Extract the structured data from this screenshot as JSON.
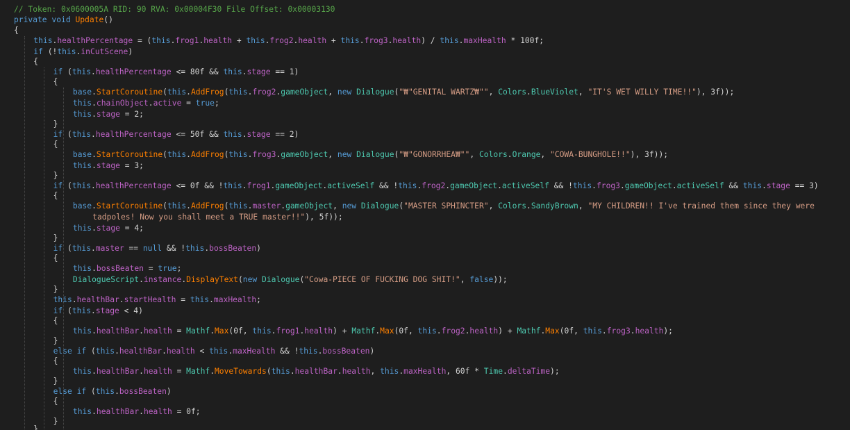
{
  "editor": {
    "language": "C#",
    "theme": {
      "background": "#1e1e1e",
      "default": "#d4d4d4",
      "keyword": "#569cd6",
      "comment": "#57a64a",
      "string": "#d69d85",
      "method": "#ff8000",
      "field": "#bd63c5",
      "type": "#4ec9b0"
    },
    "lines": [
      [
        [
          "// Token: 0x0600005A RID: 90 RVA: 0x00004F30 File Offset: 0x00003130",
          "c"
        ]
      ],
      [
        [
          "private",
          "k"
        ],
        [
          " ",
          "p"
        ],
        [
          "void",
          "k"
        ],
        [
          " ",
          "p"
        ],
        [
          "Update",
          "m"
        ],
        [
          "()",
          "p"
        ]
      ],
      [
        [
          "{",
          "p"
        ]
      ],
      [
        [
          "this",
          "k"
        ],
        [
          ".",
          "p"
        ],
        [
          "healthPercentage",
          "f"
        ],
        [
          " = (",
          "p"
        ],
        [
          "this",
          "k"
        ],
        [
          ".",
          "p"
        ],
        [
          "frog1",
          "f"
        ],
        [
          ".",
          "p"
        ],
        [
          "health",
          "f"
        ],
        [
          " + ",
          "p"
        ],
        [
          "this",
          "k"
        ],
        [
          ".",
          "p"
        ],
        [
          "frog2",
          "f"
        ],
        [
          ".",
          "p"
        ],
        [
          "health",
          "f"
        ],
        [
          " + ",
          "p"
        ],
        [
          "this",
          "k"
        ],
        [
          ".",
          "p"
        ],
        [
          "frog3",
          "f"
        ],
        [
          ".",
          "p"
        ],
        [
          "health",
          "f"
        ],
        [
          ") / ",
          "p"
        ],
        [
          "this",
          "k"
        ],
        [
          ".",
          "p"
        ],
        [
          "maxHealth",
          "f"
        ],
        [
          " * 100f;",
          "p"
        ]
      ],
      [
        [
          "if",
          "k"
        ],
        [
          " (!",
          "p"
        ],
        [
          "this",
          "k"
        ],
        [
          ".",
          "p"
        ],
        [
          "inCutScene",
          "f"
        ],
        [
          ")",
          "p"
        ]
      ],
      [
        [
          "{",
          "p"
        ]
      ],
      [
        [
          "if",
          "k"
        ],
        [
          " (",
          "p"
        ],
        [
          "this",
          "k"
        ],
        [
          ".",
          "p"
        ],
        [
          "healthPercentage",
          "f"
        ],
        [
          " <= 80f && ",
          "p"
        ],
        [
          "this",
          "k"
        ],
        [
          ".",
          "p"
        ],
        [
          "stage",
          "f"
        ],
        [
          " == 1)",
          "p"
        ]
      ],
      [
        [
          "{",
          "p"
        ]
      ],
      [
        [
          "base",
          "k"
        ],
        [
          ".",
          "p"
        ],
        [
          "StartCoroutine",
          "m"
        ],
        [
          "(",
          "p"
        ],
        [
          "this",
          "k"
        ],
        [
          ".",
          "p"
        ],
        [
          "AddFrog",
          "m"
        ],
        [
          "(",
          "p"
        ],
        [
          "this",
          "k"
        ],
        [
          ".",
          "p"
        ],
        [
          "frog2",
          "f"
        ],
        [
          ".",
          "p"
        ],
        [
          "gameObject",
          "ty"
        ],
        [
          ", ",
          "p"
        ],
        [
          "new",
          "k"
        ],
        [
          " ",
          "p"
        ],
        [
          "Dialogue",
          "ty"
        ],
        [
          "(",
          "p"
        ],
        [
          "\"₩\"GENITAL WARTZ₩\"\"",
          "s"
        ],
        [
          ", ",
          "p"
        ],
        [
          "Colors",
          "ty"
        ],
        [
          ".",
          "p"
        ],
        [
          "BlueViolet",
          "ty"
        ],
        [
          ", ",
          "p"
        ],
        [
          "\"IT'S WET WILLY TIME!!\"",
          "s"
        ],
        [
          "), 3f));",
          "p"
        ]
      ],
      [
        [
          "this",
          "k"
        ],
        [
          ".",
          "p"
        ],
        [
          "chainObject",
          "f"
        ],
        [
          ".",
          "p"
        ],
        [
          "active",
          "f"
        ],
        [
          " = ",
          "p"
        ],
        [
          "true",
          "k"
        ],
        [
          ";",
          "p"
        ]
      ],
      [
        [
          "this",
          "k"
        ],
        [
          ".",
          "p"
        ],
        [
          "stage",
          "f"
        ],
        [
          " = 2;",
          "p"
        ]
      ],
      [
        [
          "}",
          "p"
        ]
      ],
      [
        [
          "if",
          "k"
        ],
        [
          " (",
          "p"
        ],
        [
          "this",
          "k"
        ],
        [
          ".",
          "p"
        ],
        [
          "healthPercentage",
          "f"
        ],
        [
          " <= 50f && ",
          "p"
        ],
        [
          "this",
          "k"
        ],
        [
          ".",
          "p"
        ],
        [
          "stage",
          "f"
        ],
        [
          " == 2)",
          "p"
        ]
      ],
      [
        [
          "{",
          "p"
        ]
      ],
      [
        [
          "base",
          "k"
        ],
        [
          ".",
          "p"
        ],
        [
          "StartCoroutine",
          "m"
        ],
        [
          "(",
          "p"
        ],
        [
          "this",
          "k"
        ],
        [
          ".",
          "p"
        ],
        [
          "AddFrog",
          "m"
        ],
        [
          "(",
          "p"
        ],
        [
          "this",
          "k"
        ],
        [
          ".",
          "p"
        ],
        [
          "frog3",
          "f"
        ],
        [
          ".",
          "p"
        ],
        [
          "gameObject",
          "ty"
        ],
        [
          ", ",
          "p"
        ],
        [
          "new",
          "k"
        ],
        [
          " ",
          "p"
        ],
        [
          "Dialogue",
          "ty"
        ],
        [
          "(",
          "p"
        ],
        [
          "\"₩\"GONORRHEA₩\"\"",
          "s"
        ],
        [
          ", ",
          "p"
        ],
        [
          "Colors",
          "ty"
        ],
        [
          ".",
          "p"
        ],
        [
          "Orange",
          "ty"
        ],
        [
          ", ",
          "p"
        ],
        [
          "\"COWA-BUNGHOLE!!\"",
          "s"
        ],
        [
          "), 3f));",
          "p"
        ]
      ],
      [
        [
          "this",
          "k"
        ],
        [
          ".",
          "p"
        ],
        [
          "stage",
          "f"
        ],
        [
          " = 3;",
          "p"
        ]
      ],
      [
        [
          "}",
          "p"
        ]
      ],
      [
        [
          "if",
          "k"
        ],
        [
          " (",
          "p"
        ],
        [
          "this",
          "k"
        ],
        [
          ".",
          "p"
        ],
        [
          "healthPercentage",
          "f"
        ],
        [
          " <= 0f && !",
          "p"
        ],
        [
          "this",
          "k"
        ],
        [
          ".",
          "p"
        ],
        [
          "frog1",
          "f"
        ],
        [
          ".",
          "p"
        ],
        [
          "gameObject",
          "ty"
        ],
        [
          ".",
          "p"
        ],
        [
          "activeSelf",
          "ty"
        ],
        [
          " && !",
          "p"
        ],
        [
          "this",
          "k"
        ],
        [
          ".",
          "p"
        ],
        [
          "frog2",
          "f"
        ],
        [
          ".",
          "p"
        ],
        [
          "gameObject",
          "ty"
        ],
        [
          ".",
          "p"
        ],
        [
          "activeSelf",
          "ty"
        ],
        [
          " && !",
          "p"
        ],
        [
          "this",
          "k"
        ],
        [
          ".",
          "p"
        ],
        [
          "frog3",
          "f"
        ],
        [
          ".",
          "p"
        ],
        [
          "gameObject",
          "ty"
        ],
        [
          ".",
          "p"
        ],
        [
          "activeSelf",
          "ty"
        ],
        [
          " && ",
          "p"
        ],
        [
          "this",
          "k"
        ],
        [
          ".",
          "p"
        ],
        [
          "stage",
          "f"
        ],
        [
          " == 3)",
          "p"
        ]
      ],
      [
        [
          "{",
          "p"
        ]
      ],
      [
        [
          "base",
          "k"
        ],
        [
          ".",
          "p"
        ],
        [
          "StartCoroutine",
          "m"
        ],
        [
          "(",
          "p"
        ],
        [
          "this",
          "k"
        ],
        [
          ".",
          "p"
        ],
        [
          "AddFrog",
          "m"
        ],
        [
          "(",
          "p"
        ],
        [
          "this",
          "k"
        ],
        [
          ".",
          "p"
        ],
        [
          "master",
          "f"
        ],
        [
          ".",
          "p"
        ],
        [
          "gameObject",
          "ty"
        ],
        [
          ", ",
          "p"
        ],
        [
          "new",
          "k"
        ],
        [
          " ",
          "p"
        ],
        [
          "Dialogue",
          "ty"
        ],
        [
          "(",
          "p"
        ],
        [
          "\"MASTER SPHINCTER\"",
          "s"
        ],
        [
          ", ",
          "p"
        ],
        [
          "Colors",
          "ty"
        ],
        [
          ".",
          "p"
        ],
        [
          "SandyBrown",
          "ty"
        ],
        [
          ", ",
          "p"
        ],
        [
          "\"MY CHILDREN!! I've trained them since they were",
          "s"
        ]
      ],
      [
        [
          "tadpoles! Now you shall meet a TRUE master!!\"",
          "s"
        ],
        [
          "), 5f));",
          "p"
        ]
      ],
      [
        [
          "this",
          "k"
        ],
        [
          ".",
          "p"
        ],
        [
          "stage",
          "f"
        ],
        [
          " = 4;",
          "p"
        ]
      ],
      [
        [
          "}",
          "p"
        ]
      ],
      [
        [
          "if",
          "k"
        ],
        [
          " (",
          "p"
        ],
        [
          "this",
          "k"
        ],
        [
          ".",
          "p"
        ],
        [
          "master",
          "f"
        ],
        [
          " == ",
          "p"
        ],
        [
          "null",
          "k"
        ],
        [
          " && !",
          "p"
        ],
        [
          "this",
          "k"
        ],
        [
          ".",
          "p"
        ],
        [
          "bossBeaten",
          "f"
        ],
        [
          ")",
          "p"
        ]
      ],
      [
        [
          "{",
          "p"
        ]
      ],
      [
        [
          "this",
          "k"
        ],
        [
          ".",
          "p"
        ],
        [
          "bossBeaten",
          "f"
        ],
        [
          " = ",
          "p"
        ],
        [
          "true",
          "k"
        ],
        [
          ";",
          "p"
        ]
      ],
      [
        [
          "DialogueScript",
          "ty"
        ],
        [
          ".",
          "p"
        ],
        [
          "instance",
          "f"
        ],
        [
          ".",
          "p"
        ],
        [
          "DisplayText",
          "m"
        ],
        [
          "(",
          "p"
        ],
        [
          "new",
          "k"
        ],
        [
          " ",
          "p"
        ],
        [
          "Dialogue",
          "ty"
        ],
        [
          "(",
          "p"
        ],
        [
          "\"Cowa-PIECE OF FUCKING DOG SHIT!\"",
          "s"
        ],
        [
          ", ",
          "p"
        ],
        [
          "false",
          "k"
        ],
        [
          "));",
          "p"
        ]
      ],
      [
        [
          "}",
          "p"
        ]
      ],
      [
        [
          "this",
          "k"
        ],
        [
          ".",
          "p"
        ],
        [
          "healthBar",
          "f"
        ],
        [
          ".",
          "p"
        ],
        [
          "startHealth",
          "f"
        ],
        [
          " = ",
          "p"
        ],
        [
          "this",
          "k"
        ],
        [
          ".",
          "p"
        ],
        [
          "maxHealth",
          "f"
        ],
        [
          ";",
          "p"
        ]
      ],
      [
        [
          "if",
          "k"
        ],
        [
          " (",
          "p"
        ],
        [
          "this",
          "k"
        ],
        [
          ".",
          "p"
        ],
        [
          "stage",
          "f"
        ],
        [
          " < 4)",
          "p"
        ]
      ],
      [
        [
          "{",
          "p"
        ]
      ],
      [
        [
          "this",
          "k"
        ],
        [
          ".",
          "p"
        ],
        [
          "healthBar",
          "f"
        ],
        [
          ".",
          "p"
        ],
        [
          "health",
          "f"
        ],
        [
          " = ",
          "p"
        ],
        [
          "Mathf",
          "ty"
        ],
        [
          ".",
          "p"
        ],
        [
          "Max",
          "m"
        ],
        [
          "(0f, ",
          "p"
        ],
        [
          "this",
          "k"
        ],
        [
          ".",
          "p"
        ],
        [
          "frog1",
          "f"
        ],
        [
          ".",
          "p"
        ],
        [
          "health",
          "f"
        ],
        [
          ") + ",
          "p"
        ],
        [
          "Mathf",
          "ty"
        ],
        [
          ".",
          "p"
        ],
        [
          "Max",
          "m"
        ],
        [
          "(0f, ",
          "p"
        ],
        [
          "this",
          "k"
        ],
        [
          ".",
          "p"
        ],
        [
          "frog2",
          "f"
        ],
        [
          ".",
          "p"
        ],
        [
          "health",
          "f"
        ],
        [
          ") + ",
          "p"
        ],
        [
          "Mathf",
          "ty"
        ],
        [
          ".",
          "p"
        ],
        [
          "Max",
          "m"
        ],
        [
          "(0f, ",
          "p"
        ],
        [
          "this",
          "k"
        ],
        [
          ".",
          "p"
        ],
        [
          "frog3",
          "f"
        ],
        [
          ".",
          "p"
        ],
        [
          "health",
          "f"
        ],
        [
          ");",
          "p"
        ]
      ],
      [
        [
          "}",
          "p"
        ]
      ],
      [
        [
          "else",
          "k"
        ],
        [
          " ",
          "p"
        ],
        [
          "if",
          "k"
        ],
        [
          " (",
          "p"
        ],
        [
          "this",
          "k"
        ],
        [
          ".",
          "p"
        ],
        [
          "healthBar",
          "f"
        ],
        [
          ".",
          "p"
        ],
        [
          "health",
          "f"
        ],
        [
          " < ",
          "p"
        ],
        [
          "this",
          "k"
        ],
        [
          ".",
          "p"
        ],
        [
          "maxHealth",
          "f"
        ],
        [
          " && !",
          "p"
        ],
        [
          "this",
          "k"
        ],
        [
          ".",
          "p"
        ],
        [
          "bossBeaten",
          "f"
        ],
        [
          ")",
          "p"
        ]
      ],
      [
        [
          "{",
          "p"
        ]
      ],
      [
        [
          "this",
          "k"
        ],
        [
          ".",
          "p"
        ],
        [
          "healthBar",
          "f"
        ],
        [
          ".",
          "p"
        ],
        [
          "health",
          "f"
        ],
        [
          " = ",
          "p"
        ],
        [
          "Mathf",
          "ty"
        ],
        [
          ".",
          "p"
        ],
        [
          "MoveTowards",
          "m"
        ],
        [
          "(",
          "p"
        ],
        [
          "this",
          "k"
        ],
        [
          ".",
          "p"
        ],
        [
          "healthBar",
          "f"
        ],
        [
          ".",
          "p"
        ],
        [
          "health",
          "f"
        ],
        [
          ", ",
          "p"
        ],
        [
          "this",
          "k"
        ],
        [
          ".",
          "p"
        ],
        [
          "maxHealth",
          "f"
        ],
        [
          ", 60f * ",
          "p"
        ],
        [
          "Time",
          "ty"
        ],
        [
          ".",
          "p"
        ],
        [
          "deltaTime",
          "f"
        ],
        [
          ");",
          "p"
        ]
      ],
      [
        [
          "}",
          "p"
        ]
      ],
      [
        [
          "else",
          "k"
        ],
        [
          " ",
          "p"
        ],
        [
          "if",
          "k"
        ],
        [
          " (",
          "p"
        ],
        [
          "this",
          "k"
        ],
        [
          ".",
          "p"
        ],
        [
          "bossBeaten",
          "f"
        ],
        [
          ")",
          "p"
        ]
      ],
      [
        [
          "{",
          "p"
        ]
      ],
      [
        [
          "this",
          "k"
        ],
        [
          ".",
          "p"
        ],
        [
          "healthBar",
          "f"
        ],
        [
          ".",
          "p"
        ],
        [
          "health",
          "f"
        ],
        [
          " = 0f;",
          "p"
        ]
      ],
      [
        [
          "}",
          "p"
        ]
      ],
      [
        [
          "}",
          "p"
        ]
      ]
    ]
  }
}
